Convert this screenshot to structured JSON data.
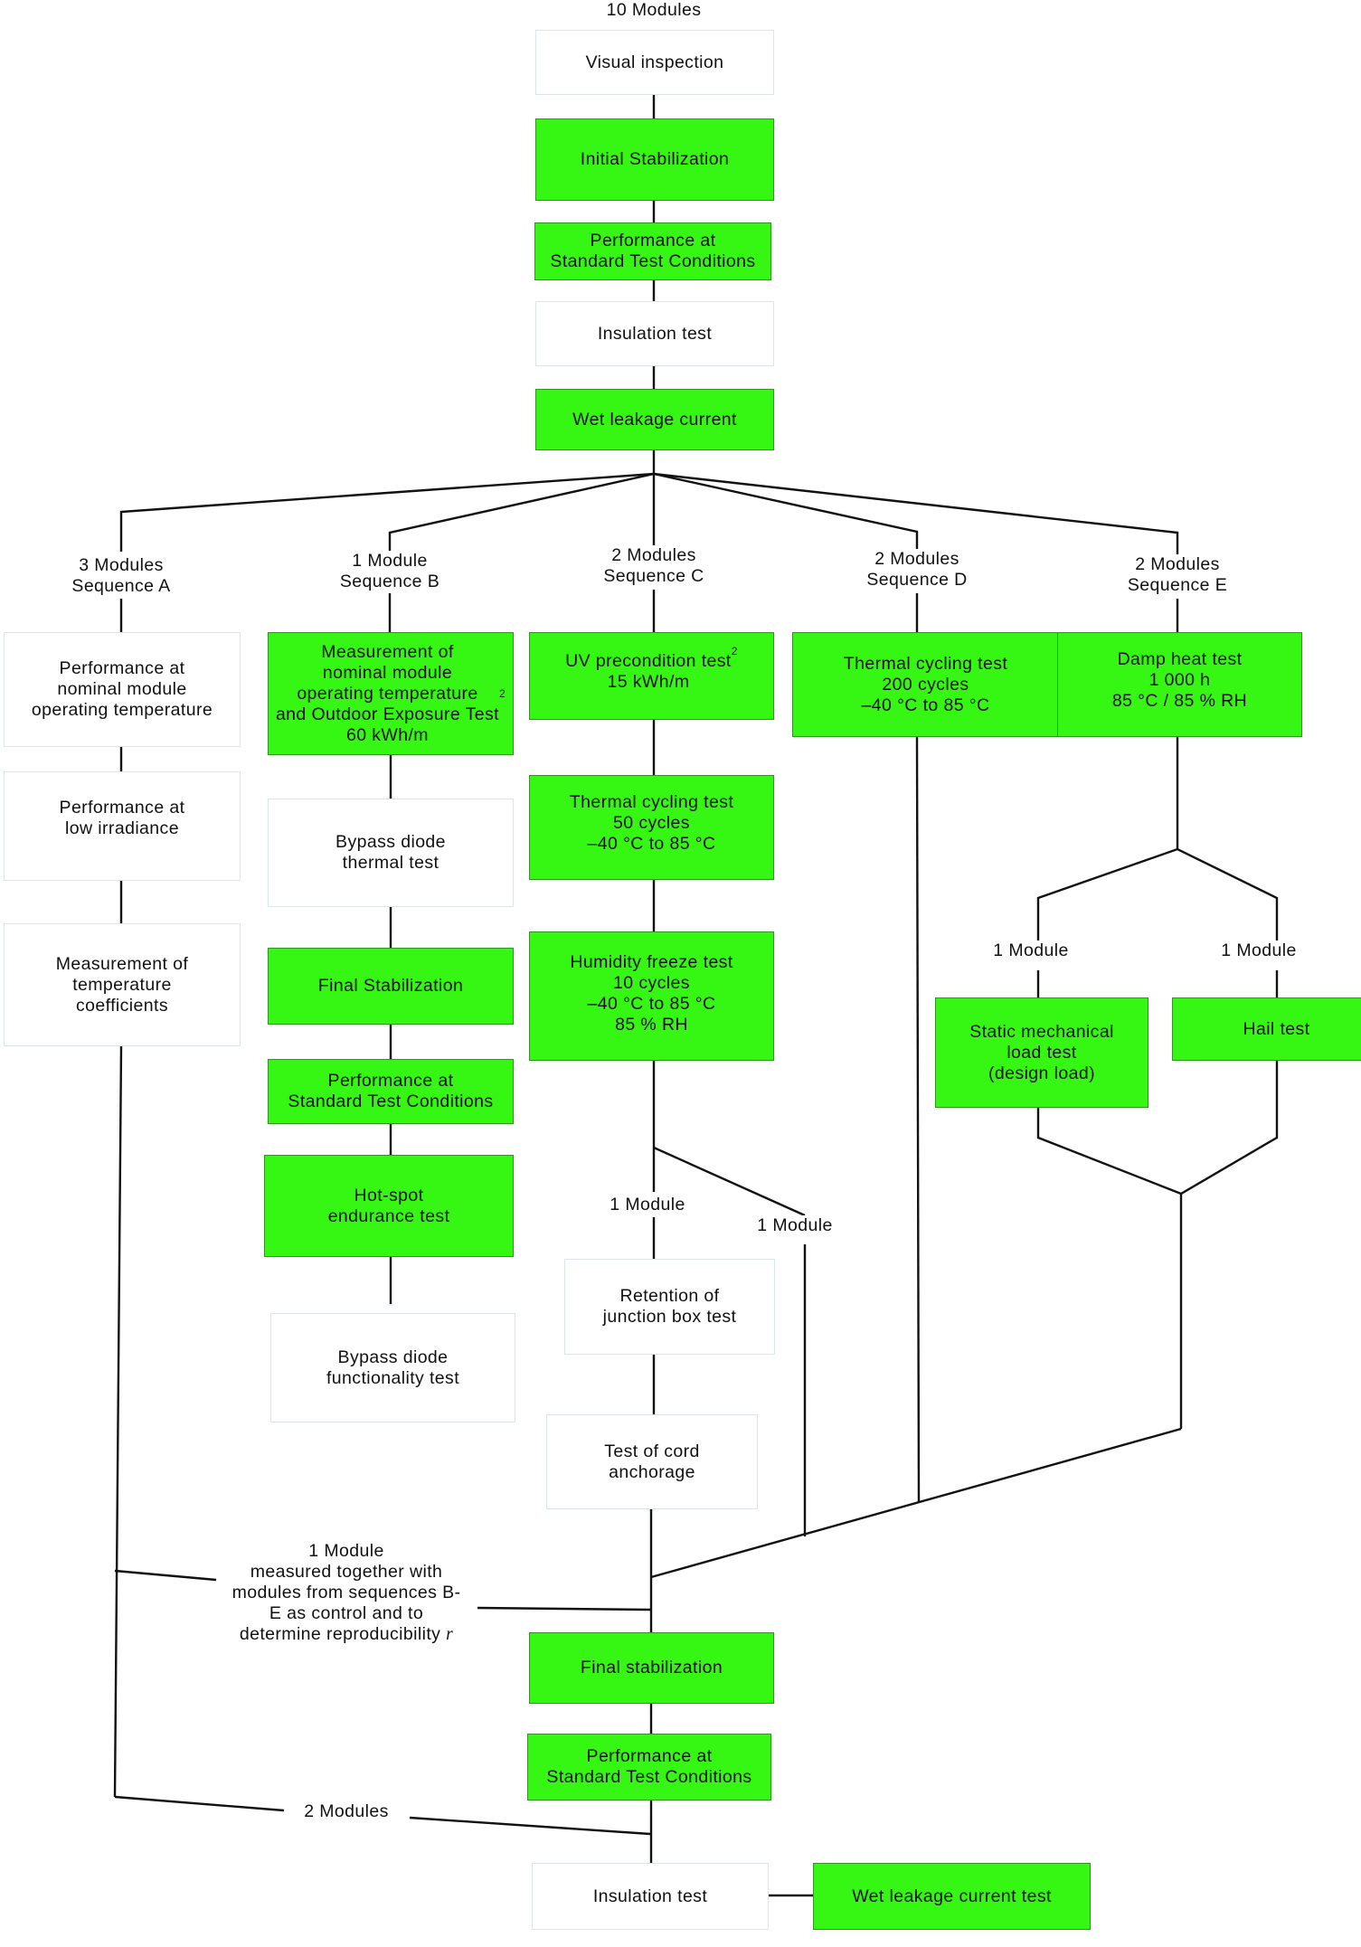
{
  "diagram": {
    "type": "flowchart",
    "title_count": "10 Modules",
    "colors": {
      "highlight": "#36f714",
      "plain": "#ffffff",
      "connector": "#111111"
    },
    "trunk": [
      {
        "id": "visual",
        "label": "Visual inspection",
        "style": "plain"
      },
      {
        "id": "initial-stab",
        "label": "Initial Stabilization",
        "style": "highlight"
      },
      {
        "id": "perf-stc-1",
        "label": "Performance at\nStandard Test Conditions",
        "style": "highlight"
      },
      {
        "id": "insulation-1",
        "label": "Insulation test",
        "style": "plain"
      },
      {
        "id": "wet-leak-1",
        "label": "Wet leakage current",
        "style": "highlight"
      }
    ],
    "sequences": {
      "A": {
        "label": "3 Modules\nSequence A",
        "steps": [
          {
            "label": "Performance at\nnominal module\noperating temperature",
            "style": "plain"
          },
          {
            "label": "Performance at\nlow irradiance",
            "style": "plain"
          },
          {
            "label": "Measurement of\ntemperature\ncoefficients",
            "style": "plain"
          }
        ]
      },
      "B": {
        "label": "1 Module\nSequence B",
        "steps": [
          {
            "label": "Measurement of\nnominal module\noperating temperature\nand Outdoor Exposure Test\n60 kWh/m",
            "sup": "2",
            "style": "highlight"
          },
          {
            "label": "Bypass diode\nthermal test",
            "style": "plain"
          },
          {
            "label": "Final Stabilization",
            "style": "highlight"
          },
          {
            "label": "Performance at\nStandard Test Conditions",
            "style": "highlight"
          },
          {
            "label": "Hot-spot\nendurance test",
            "style": "highlight"
          },
          {
            "label": "Bypass diode\nfunctionality test",
            "style": "plain"
          }
        ]
      },
      "C": {
        "label": "2 Modules\nSequence C",
        "steps": [
          {
            "label": "UV precondition test\n15 kWh/m",
            "sup": "2",
            "style": "highlight"
          },
          {
            "label": "Thermal cycling test\n50 cycles\n–40 °C to 85 °C",
            "style": "highlight"
          },
          {
            "label": "Humidity freeze test\n10 cycles\n–40 °C to 85 °C\n85 % RH",
            "style": "highlight"
          },
          {
            "label": "Retention of\njunction box test",
            "style": "plain"
          },
          {
            "label": "Test of cord\nanchorage",
            "style": "plain"
          }
        ],
        "branch_left": "1 Module",
        "branch_right": "1 Module"
      },
      "D": {
        "label": "2 Modules\nSequence D",
        "steps": [
          {
            "label": "Thermal cycling test\n200 cycles\n–40 °C to 85 °C",
            "style": "highlight"
          }
        ]
      },
      "E": {
        "label": "2 Modules\nSequence E",
        "steps": [
          {
            "label": "Damp heat test\n1 000 h\n85 °C / 85 % RH",
            "style": "highlight"
          },
          {
            "label": "Static mechanical\nload test\n(design load)",
            "style": "highlight"
          },
          {
            "label": "Hail test",
            "style": "highlight"
          }
        ],
        "branch_left": "1 Module",
        "branch_right": "1 Module"
      }
    },
    "control_note": "1 Module\nmeasured together with\nmodules from sequences B-\nE as control and to\ndetermine reproducibility ",
    "control_note_var": "r",
    "two_modules": "2 Modules",
    "final": [
      {
        "label": "Final stabilization",
        "style": "highlight"
      },
      {
        "label": "Performance at\nStandard Test Conditions",
        "style": "highlight"
      },
      {
        "label": "Insulation test",
        "style": "plain"
      },
      {
        "label": "Wet leakage current test",
        "style": "highlight"
      }
    ]
  }
}
